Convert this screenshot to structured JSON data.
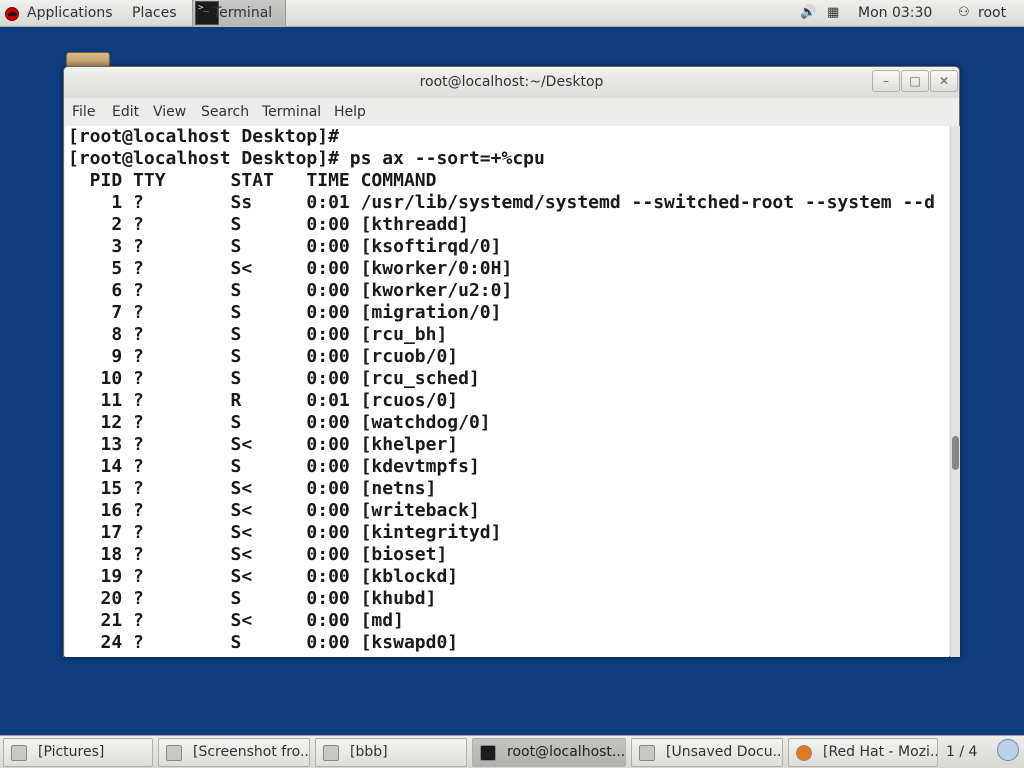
{
  "top_panel": {
    "applications": "Applications",
    "places": "Places",
    "task_terminal": "Terminal",
    "clock": "Mon 03:30",
    "user": "root"
  },
  "window": {
    "title": "root@localhost:~/Desktop",
    "menu": [
      "File",
      "Edit",
      "View",
      "Search",
      "Terminal",
      "Help"
    ]
  },
  "terminal": {
    "lines": [
      "[root@localhost Desktop]#",
      "[root@localhost Desktop]# ps ax --sort=+%cpu",
      "  PID TTY      STAT   TIME COMMAND",
      "    1 ?        Ss     0:01 /usr/lib/systemd/systemd --switched-root --system --d",
      "    2 ?        S      0:00 [kthreadd]",
      "    3 ?        S      0:00 [ksoftirqd/0]",
      "    5 ?        S<     0:00 [kworker/0:0H]",
      "    6 ?        S      0:00 [kworker/u2:0]",
      "    7 ?        S      0:00 [migration/0]",
      "    8 ?        S      0:00 [rcu_bh]",
      "    9 ?        S      0:00 [rcuob/0]",
      "   10 ?        S      0:00 [rcu_sched]",
      "   11 ?        R      0:01 [rcuos/0]",
      "   12 ?        S      0:00 [watchdog/0]",
      "   13 ?        S<     0:00 [khelper]",
      "   14 ?        S      0:00 [kdevtmpfs]",
      "   15 ?        S<     0:00 [netns]",
      "   16 ?        S<     0:00 [writeback]",
      "   17 ?        S<     0:00 [kintegrityd]",
      "   18 ?        S<     0:00 [bioset]",
      "   19 ?        S<     0:00 [kblockd]",
      "   20 ?        S      0:00 [khubd]",
      "   21 ?        S<     0:00 [md]",
      "   24 ?        S      0:00 [kswapd0]"
    ]
  },
  "taskbar": {
    "tasks": [
      "[Pictures]",
      "[Screenshot fro...",
      "[bbb]",
      "root@localhost...",
      "[Unsaved Docu...",
      "[Red Hat - Mozi..."
    ],
    "workspace": "1 / 4"
  },
  "colors": {
    "desktop_bg": "#0d3d7e",
    "terminal_bg": "#ffffff",
    "terminal_fg": "#1a1a1a"
  }
}
